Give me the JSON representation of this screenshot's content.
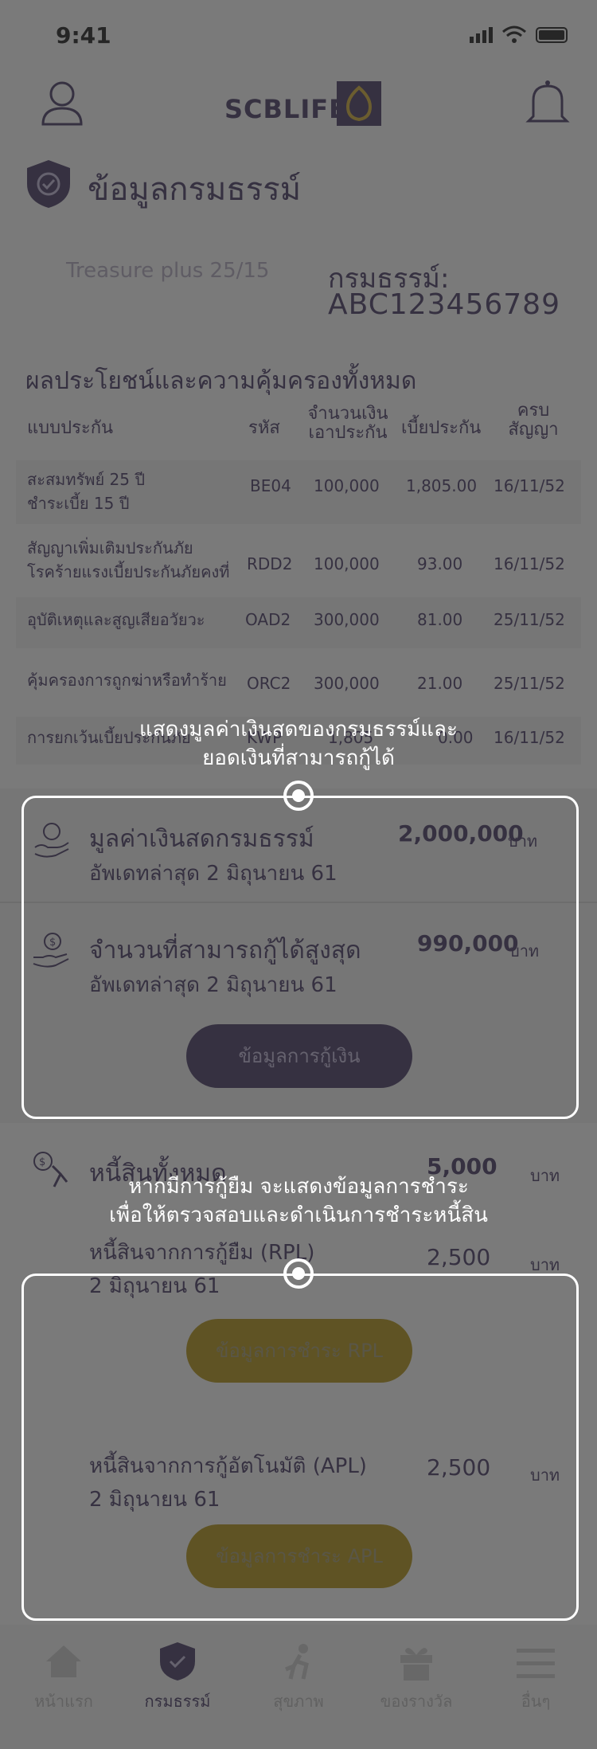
{
  "status_bar": {
    "time": "9:41"
  },
  "header": {
    "brand": "SCBLIFE"
  },
  "page": {
    "title": "ข้อมูลกรมธรรม์"
  },
  "policy": {
    "plan_name": "Treasure plus 25/15",
    "label": "กรมธรรม์:",
    "number": "ABC123456789"
  },
  "benefits": {
    "title": "ผลประโยชน์และความคุ้มครองทั้งหมด",
    "columns": [
      "แบบประกัน",
      "รหัส",
      "จำนวนเงิน",
      "เอาประกัน",
      "เบี้ยประกัน",
      "ครบ",
      "สัญญา"
    ],
    "rows": [
      {
        "name1": "สะสมทรัพย์ 25 ปี",
        "name2": "ชำระเบี้ย 15 ปี",
        "code": "BE04",
        "sum": "100,000",
        "premium": "1,805.00",
        "maturity": "16/11/52"
      },
      {
        "name1": "สัญญาเพิ่มเติมประกันภัย",
        "name2": "โรคร้ายแรงเบี้ยประกันภัยคงที่",
        "code": "RDD2",
        "sum": "100,000",
        "premium": "93.00",
        "maturity": "16/11/52"
      },
      {
        "name1": "อุบัติเหตุและสูญเสียอวัยวะ",
        "name2": "",
        "code": "OAD2",
        "sum": "300,000",
        "premium": "81.00",
        "maturity": "25/11/52"
      },
      {
        "name1": "คุ้มครองการถูกฆ่าหรือทำร้าย",
        "name2": "",
        "code": "ORC2",
        "sum": "300,000",
        "premium": "21.00",
        "maturity": "25/11/52"
      },
      {
        "name1": "การยกเว้นเบี้ยประกันภัย",
        "name2": "",
        "code": "KWP",
        "sum": "1,805",
        "premium": "0.00",
        "maturity": "16/11/52"
      }
    ]
  },
  "cash_value": {
    "title": "มูลค่าเงินสดกรมธรรม์",
    "updated": "อัพเดทล่าสุด 2 มิถุนายน 61",
    "amount": "2,000,000",
    "unit": "บาท"
  },
  "max_loan": {
    "title": "จำนวนที่สามารถกู้ได้สูงสุด",
    "updated": "อัพเดทล่าสุด 2 มิถุนายน 61",
    "amount": "990,000",
    "unit": "บาท",
    "button": "ข้อมูลการกู้เงิน"
  },
  "debt": {
    "title": "หนี้สินทั้งหมด",
    "amount": "5,000",
    "unit": "บาท",
    "rpl": {
      "title": "หนี้สินจากการกู้ยืม (RPL)",
      "date": "2 มิถุนายน 61",
      "amount": "2,500",
      "unit": "บาท",
      "button": "ข้อมูลการชำระ RPL"
    },
    "apl": {
      "title": "หนี้สินจากการกู้อัตโนมัติ (APL)",
      "date": "2 มิถุนายน 61",
      "amount": "2,500",
      "unit": "บาท",
      "button": "ข้อมูลการชำระ APL"
    }
  },
  "tips": {
    "tip1_line1": "แสดงมูลค่าเงินสดของกรมธรรม์และ",
    "tip1_line2": "ยอดเงินที่สามารถกู้ได้",
    "tip2_line1": "หากมีการกู้ยืม จะแสดงข้อมูลการชำระ",
    "tip2_line2": "เพื่อให้ตรวจสอบและดำเนินการชำระหนี้สิน"
  },
  "tabbar": {
    "items": [
      {
        "label": "หน้าแรก",
        "icon": "home-icon"
      },
      {
        "label": "กรมธรรม์",
        "icon": "shield-check-icon"
      },
      {
        "label": "สุขภาพ",
        "icon": "run-icon"
      },
      {
        "label": "ของรางวัล",
        "icon": "gift-icon"
      },
      {
        "label": "อื่นๆ",
        "icon": "menu-icon"
      }
    ]
  },
  "colors": {
    "primary": "#4d3f6b",
    "accent_yellow": "#f3c316",
    "overlay": "#282828"
  }
}
